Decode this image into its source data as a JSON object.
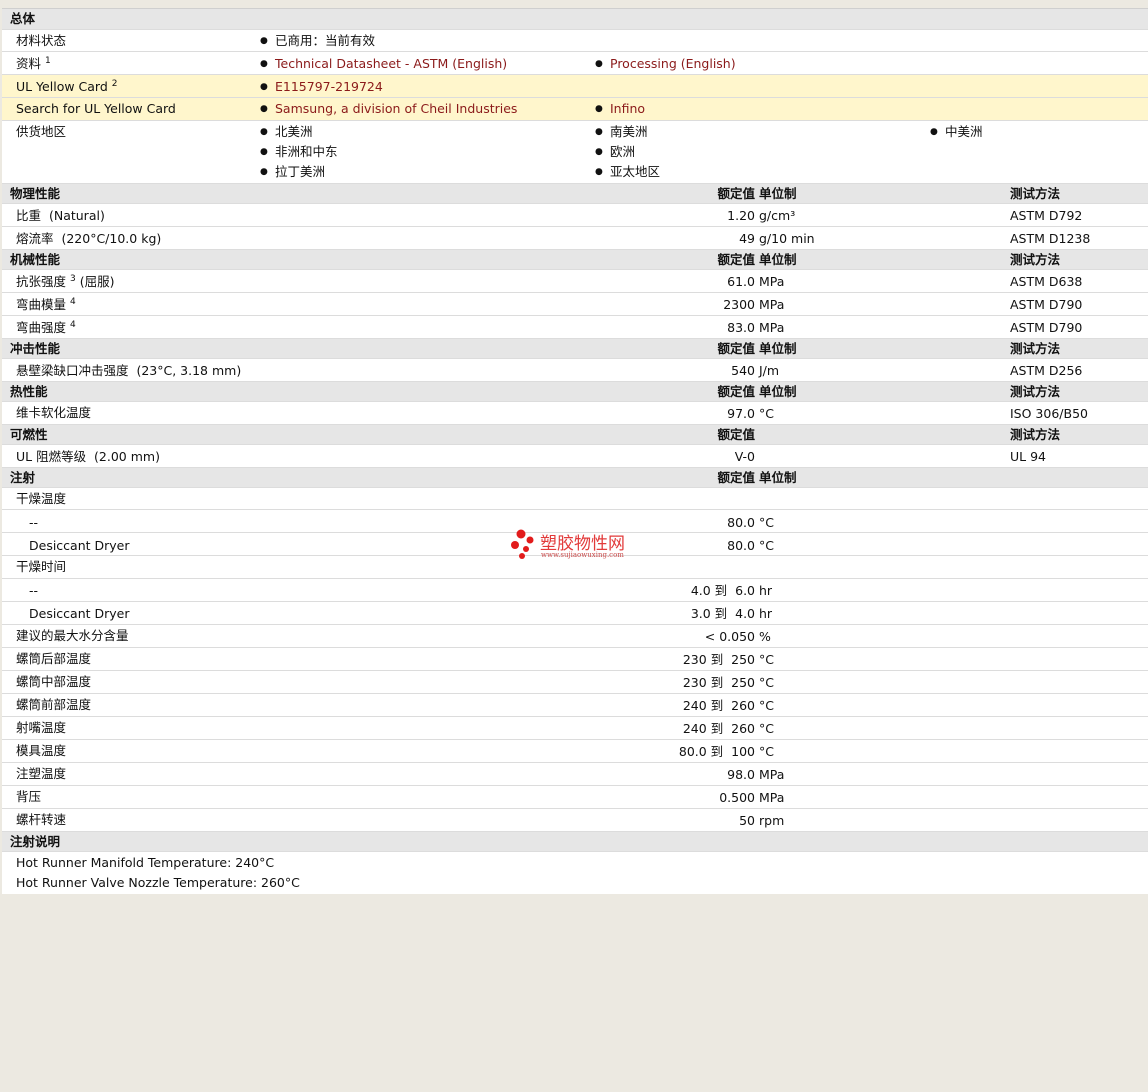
{
  "general": {
    "title": "总体",
    "material_status_label": "材料状态",
    "material_status_value": "已商用：当前有效",
    "docs_label": "资料",
    "docs_sup": "1",
    "docs": [
      "Technical Datasheet - ASTM (English)",
      "Processing (English)"
    ],
    "ul_label": "UL Yellow Card",
    "ul_sup": "2",
    "ul_value": "E115797-219724",
    "search_label": "Search for UL Yellow Card",
    "search_links": [
      "Samsung, a division of Cheil Industries",
      "Infino"
    ],
    "supply_label": "供货地区",
    "regions": [
      "北美洲",
      "南美洲",
      "中美洲",
      "非洲和中东",
      "欧洲",
      "拉丁美洲",
      "亚太地区"
    ]
  },
  "headers": {
    "rated": "额定值",
    "unit": "单位制",
    "method": "测试方法"
  },
  "physical": {
    "title": "物理性能",
    "rows": [
      {
        "label": "比重",
        "cond": "(Natural)",
        "value": "1.20",
        "unit": "g/cm³",
        "method": "ASTM D792"
      },
      {
        "label": "熔流率",
        "cond": "(220°C/10.0 kg)",
        "value": "49",
        "unit": "g/10 min",
        "method": "ASTM D1238"
      }
    ]
  },
  "mechanical": {
    "title": "机械性能",
    "rows": [
      {
        "label": "抗张强度",
        "sup": "3",
        "cond": "(屈服)",
        "value": "61.0",
        "unit": "MPa",
        "method": "ASTM D638"
      },
      {
        "label": "弯曲模量",
        "sup": "4",
        "value": "2300",
        "unit": "MPa",
        "method": "ASTM D790"
      },
      {
        "label": "弯曲强度",
        "sup": "4",
        "value": "83.0",
        "unit": "MPa",
        "method": "ASTM D790"
      }
    ]
  },
  "impact": {
    "title": "冲击性能",
    "rows": [
      {
        "label": "悬壁梁缺口冲击强度",
        "cond": "(23°C, 3.18 mm)",
        "value": "540",
        "unit": "J/m",
        "method": "ASTM D256"
      }
    ]
  },
  "thermal": {
    "title": "热性能",
    "rows": [
      {
        "label": "维卡软化温度",
        "value": "97.0",
        "unit": "°C",
        "method": "ISO 306/B50"
      }
    ]
  },
  "flammability": {
    "title": "可燃性",
    "rows": [
      {
        "label": "UL 阻燃等级",
        "cond": "(2.00 mm)",
        "value": "V-0",
        "method": "UL 94"
      }
    ]
  },
  "injection": {
    "title": "注射",
    "rows": [
      {
        "label": "干燥温度"
      },
      {
        "sub": "--",
        "value": "80.0",
        "unit": "°C"
      },
      {
        "sub": "Desiccant Dryer",
        "value": "80.0",
        "unit": "°C"
      },
      {
        "label": "干燥时间"
      },
      {
        "sub": "--",
        "value": "4.0 到  6.0",
        "unit": "hr"
      },
      {
        "sub": "Desiccant Dryer",
        "value": "3.0 到  4.0",
        "unit": "hr"
      },
      {
        "label": "建议的最大水分含量",
        "value": "< 0.050",
        "unit": "%"
      },
      {
        "label": "螺筒后部温度",
        "value": "230 到  250",
        "unit": "°C"
      },
      {
        "label": "螺筒中部温度",
        "value": "230 到  250",
        "unit": "°C"
      },
      {
        "label": "螺筒前部温度",
        "value": "240 到  260",
        "unit": "°C"
      },
      {
        "label": "射嘴温度",
        "value": "240 到  260",
        "unit": "°C"
      },
      {
        "label": "模具温度",
        "value": "80.0 到  100",
        "unit": "°C"
      },
      {
        "label": "注塑温度",
        "value": "98.0",
        "unit": "MPa"
      },
      {
        "label": "背压",
        "value": "0.500",
        "unit": "MPa"
      },
      {
        "label": "螺杆转速",
        "value": "50",
        "unit": "rpm"
      }
    ]
  },
  "notes": {
    "title": "注射说明",
    "lines": [
      "Hot Runner Manifold Temperature: 240°C",
      "Hot Runner Valve Nozzle Temperature: 260°C"
    ]
  },
  "watermark": {
    "text": "塑胶物性网",
    "url": "www.sujiaowuxing.com",
    "color": "#e23a3a"
  }
}
